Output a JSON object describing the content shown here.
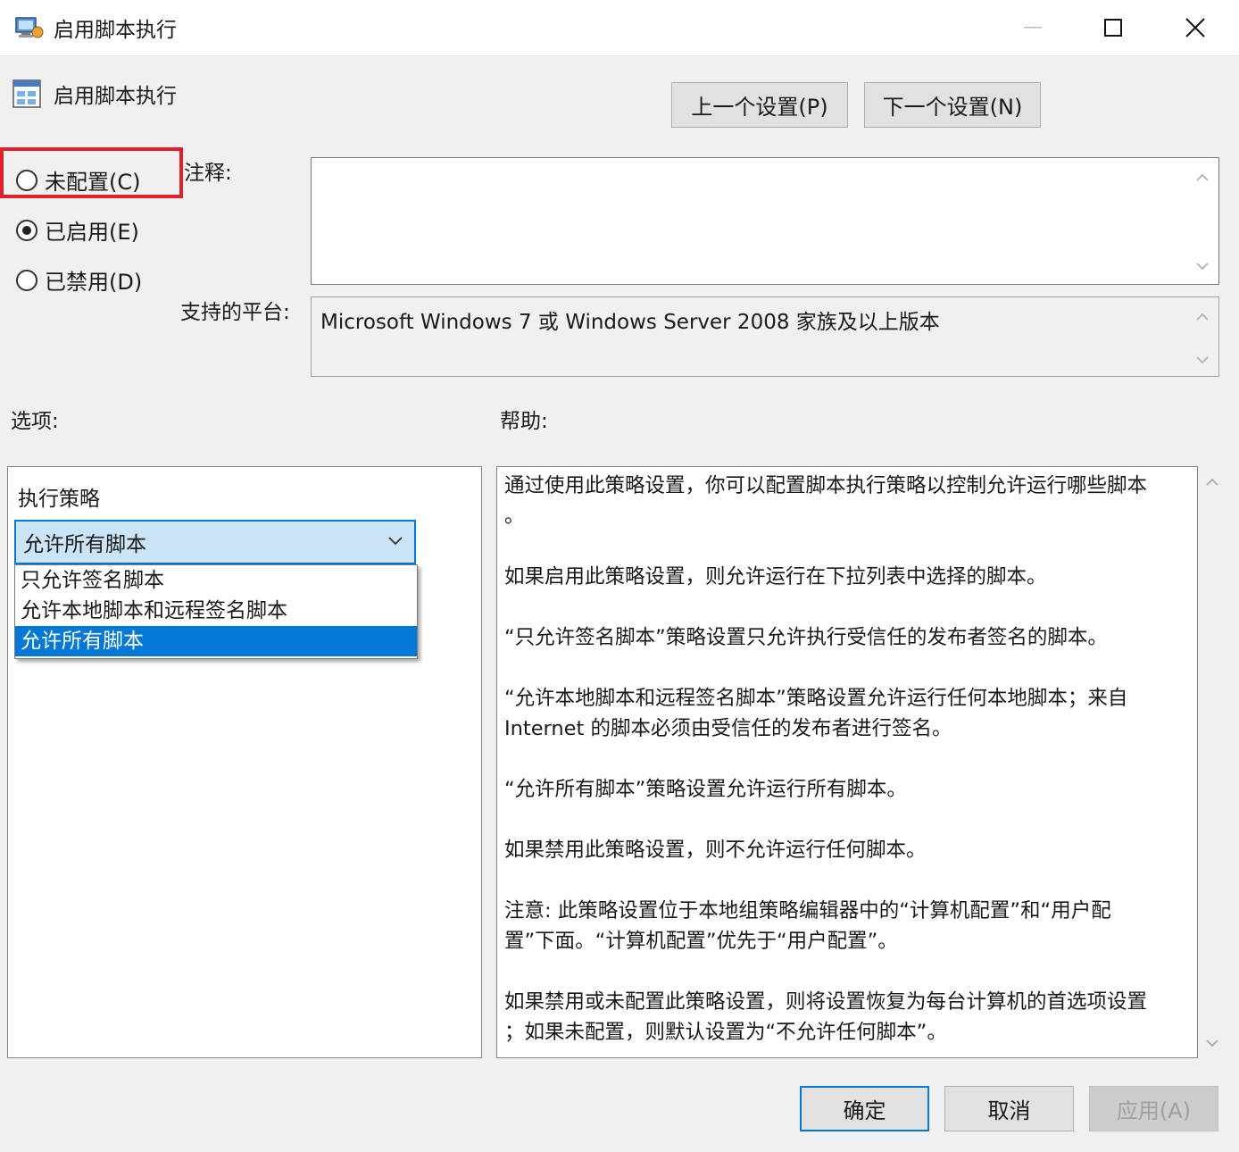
{
  "window": {
    "title": "启用脚本执行"
  },
  "header": {
    "policy_name": "启用脚本执行",
    "prev_button": "上一个设置(P)",
    "next_button": "下一个设置(N)"
  },
  "state": {
    "options": [
      {
        "label": "未配置(C)",
        "checked": false
      },
      {
        "label": "已启用(E)",
        "checked": true
      },
      {
        "label": "已禁用(D)",
        "checked": false
      }
    ]
  },
  "comment": {
    "label": "注释:",
    "value": ""
  },
  "platform": {
    "label": "支持的平台:",
    "value": "Microsoft Windows 7 或 Windows Server 2008 家族及以上版本"
  },
  "options_section": {
    "label": "选项:",
    "policy_label": "执行策略",
    "selected": "允许所有脚本",
    "items": [
      "只允许签名脚本",
      "允许本地脚本和远程签名脚本",
      "允许所有脚本"
    ]
  },
  "help_section": {
    "label": "帮助:",
    "lines": [
      "通过使用此策略设置，你可以配置脚本执行策略以控制允许运行哪些脚本",
      "。",
      "",
      "如果启用此策略设置，则允许运行在下拉列表中选择的脚本。",
      "",
      " “只允许签名脚本”策略设置只允许执行受信任的发布者签名的脚本。",
      "",
      " “允许本地脚本和远程签名脚本”策略设置允许运行任何本地脚本；来自",
      "Internet 的脚本必须由受信任的发布者进行签名。",
      "",
      " “允许所有脚本”策略设置允许运行所有脚本。",
      "",
      "如果禁用此策略设置，则不允许运行任何脚本。",
      "",
      "注意: 此策略设置位于本地组策略编辑器中的“计算机配置”和“用户配",
      "置”下面。“计算机配置”优先于“用户配置”。",
      "",
      "如果禁用或未配置此策略设置，则将设置恢复为每台计算机的首选项设置",
      "；如果未配置，则默认设置为“不允许任何脚本”。"
    ]
  },
  "footer": {
    "ok": "确定",
    "cancel": "取消",
    "apply": "应用(A)"
  },
  "colors": {
    "accent": "#0078d7",
    "highlight_box": "#e0202a"
  }
}
